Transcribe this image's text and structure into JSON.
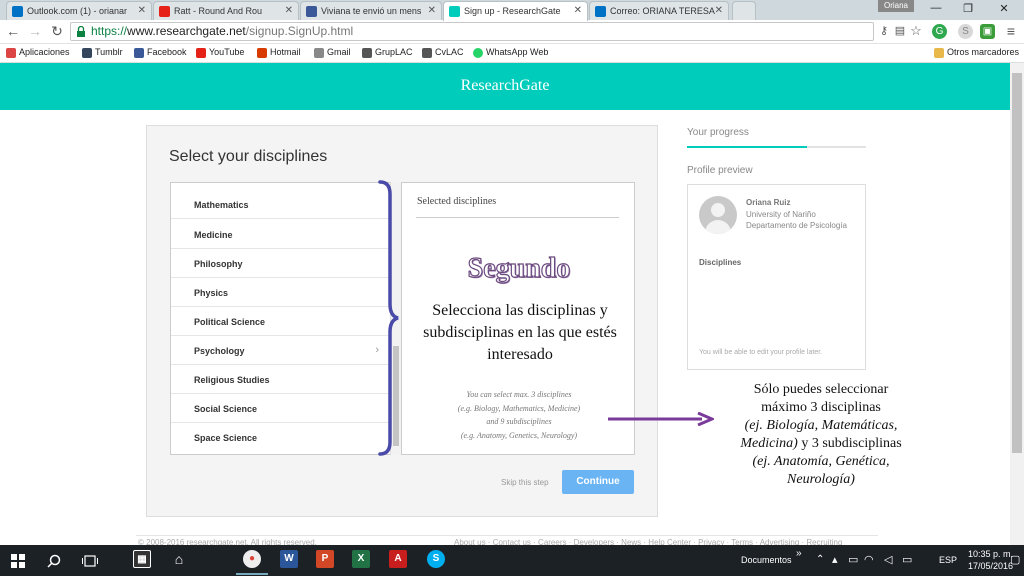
{
  "browser": {
    "tabs": [
      {
        "label": "Outlook.com (1) - orianar",
        "color": "#0072c6"
      },
      {
        "label": "Ratt - Round And Rou",
        "color": "#e62117"
      },
      {
        "label": "Viviana te envió un mens",
        "color": "#3b5998"
      },
      {
        "label": "Sign up - ResearchGate",
        "color": "#00ccbb"
      },
      {
        "label": "Correo: ORIANA TERESA",
        "color": "#0072c6"
      }
    ],
    "profile_name": "Oriana",
    "url_scheme": "https://",
    "url_host": "www.researchgate.net",
    "url_path": "/signup.SignUp.html",
    "bookmarks": [
      {
        "label": "Aplicaciones",
        "color": "#d44"
      },
      {
        "label": "Tumblr",
        "color": "#35465c"
      },
      {
        "label": "Facebook",
        "color": "#3b5998"
      },
      {
        "label": "YouTube",
        "color": "#e62117"
      },
      {
        "label": "Hotmail",
        "color": "#d83b01"
      },
      {
        "label": "Gmail",
        "color": "#888"
      },
      {
        "label": "GrupLAC",
        "color": "#555"
      },
      {
        "label": "CvLAC",
        "color": "#555"
      },
      {
        "label": "WhatsApp Web",
        "color": "#25d366"
      }
    ],
    "other_bookmarks": "Otros marcadores"
  },
  "page": {
    "logo": "ResearchGate",
    "card_title": "Select your disciplines",
    "disciplines": [
      "Mathematics",
      "Medicine",
      "Philosophy",
      "Physics",
      "Political Science",
      "Psychology",
      "Religious Studies",
      "Social Science",
      "Space Science"
    ],
    "selected_title": "Selected disciplines",
    "overlay_title": "Segundo",
    "overlay_text": "Selecciona las disciplinas y subdisciplinas en las que estés interesado",
    "hint_lines": [
      "You can select max. 3 disciplines",
      "(e.g. Biology, Mathematics, Medicine)",
      "and 9 subdisciplines",
      "(e.g. Anatomy, Genetics, Neurology)"
    ],
    "skip_label": "Skip this step",
    "continue_label": "Continue",
    "progress_label": "Your progress",
    "progress_fraction": 0.67,
    "preview_label": "Profile preview",
    "profile_name": "Oriana Ruiz",
    "profile_institution": "University of Nariño",
    "profile_department": "Departamento de Psicología",
    "preview_disciplines": "Disciplines",
    "preview_note": "You will be able to edit your profile later.",
    "side_note_line1": "Sólo puedes seleccionar",
    "side_note_line2": "máximo 3 disciplinas",
    "side_note_line3": "(ej. Biología, Matemáticas,",
    "side_note_line4a": "Medicina)",
    "side_note_line4b": " y 3 subdisciplinas",
    "side_note_line5": "(ej. Anatomía, Genética,",
    "side_note_line6": "Neurología)",
    "footer_copyright": "© 2008-2016 researchgate.net. All rights reserved.",
    "footer_links": "About us · Contact us · Careers · Developers · News · Help Center · Privacy · Terms · Advertising · Recruiting"
  },
  "taskbar": {
    "documents_label": "Documentos",
    "language": "ESP",
    "time": "10:35 p. m.",
    "date": "17/05/2016"
  }
}
